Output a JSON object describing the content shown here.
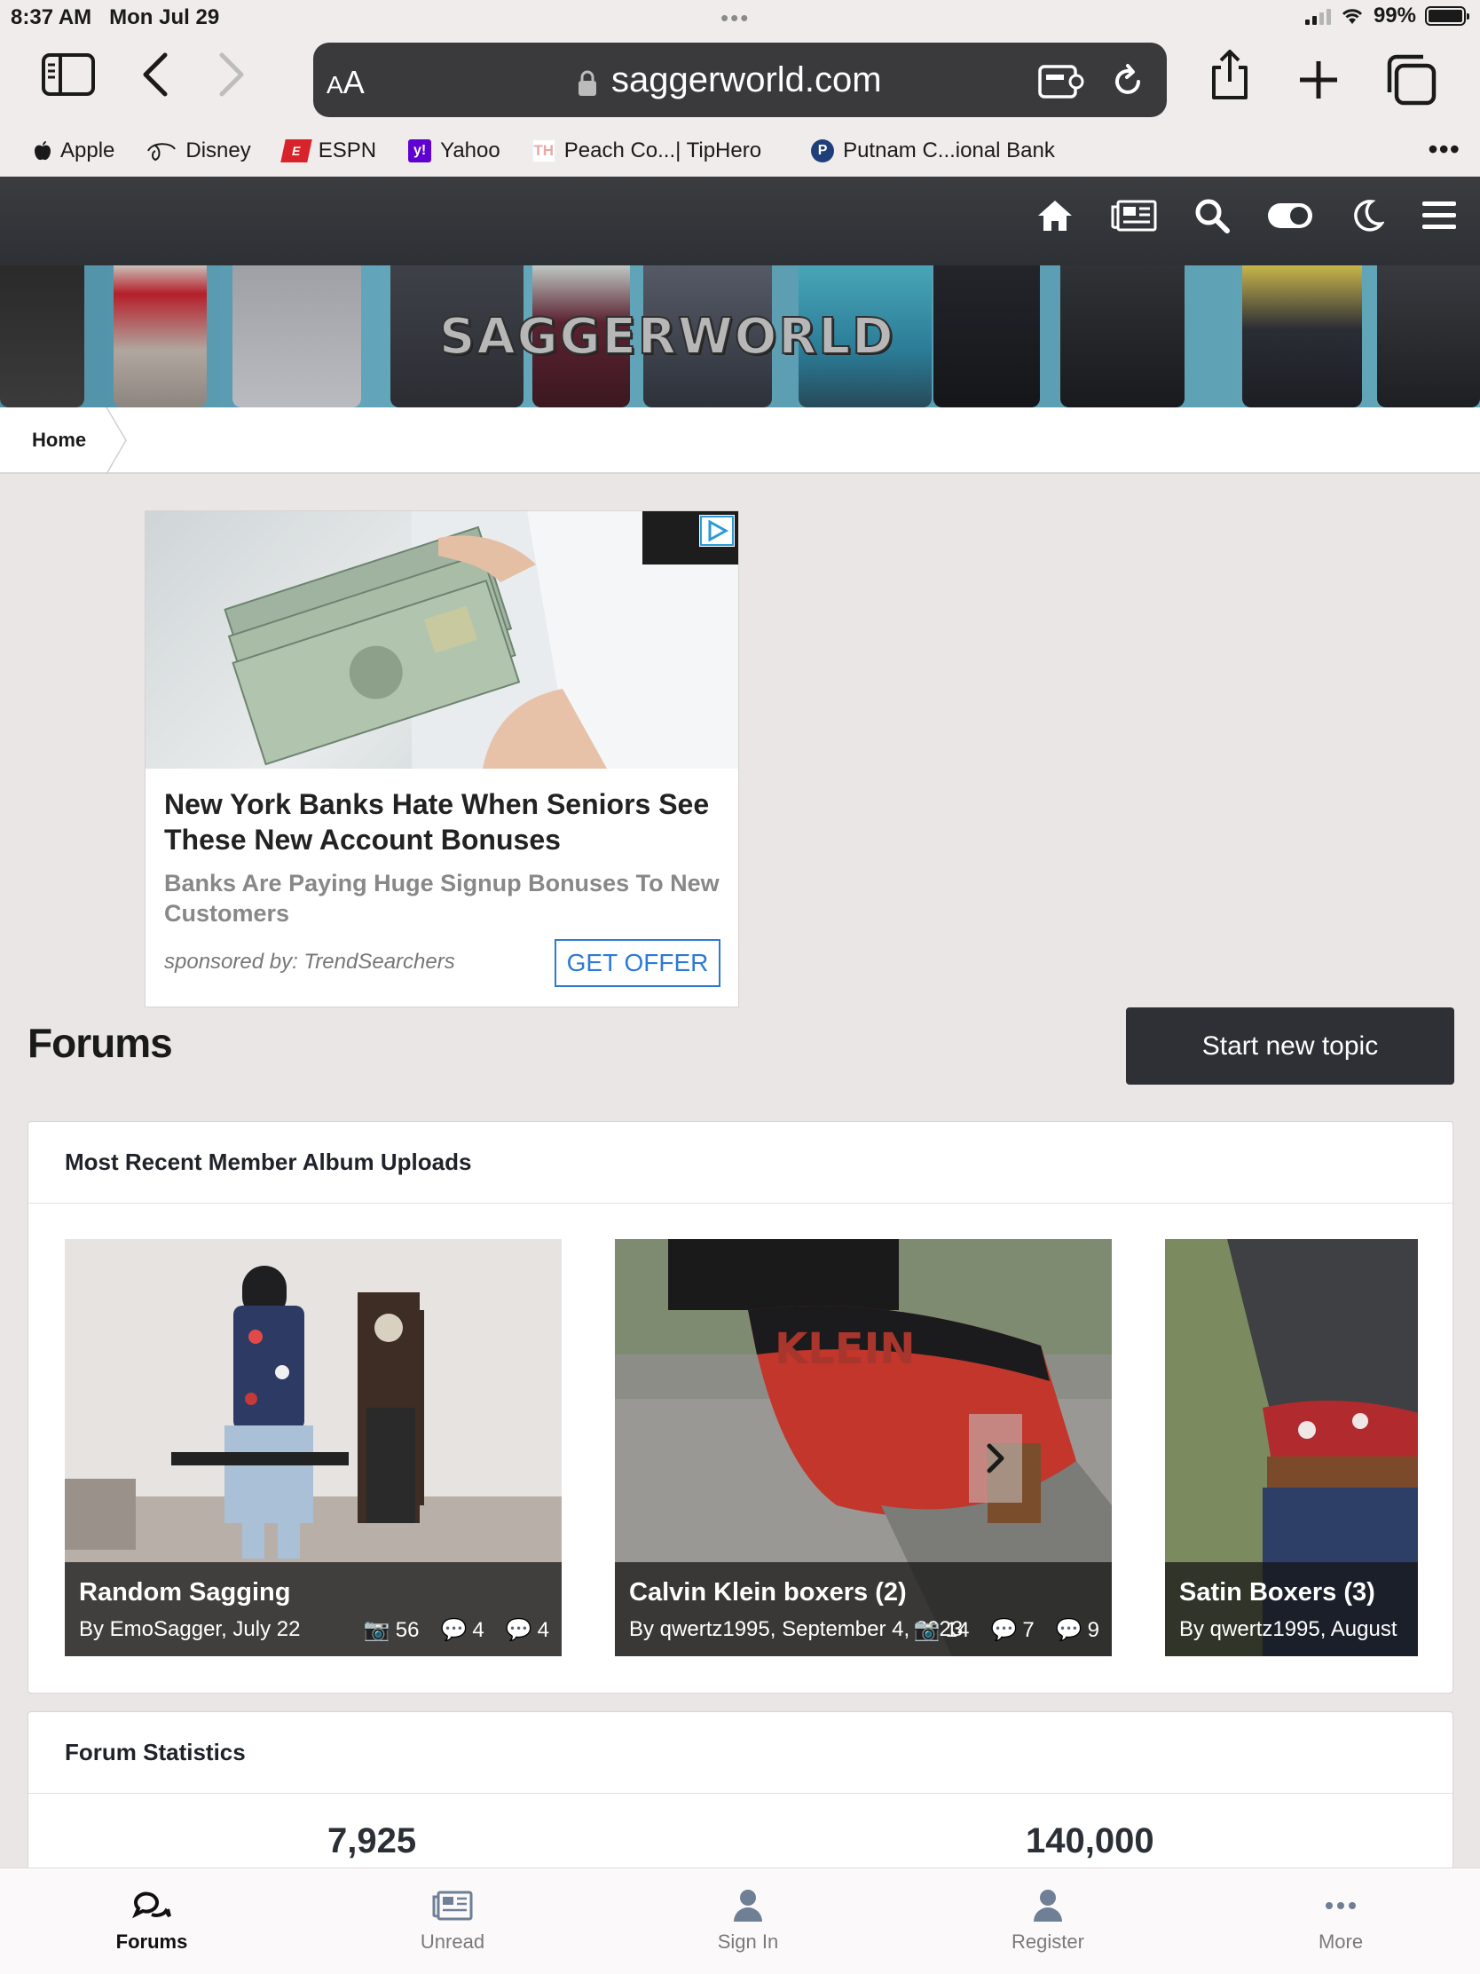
{
  "status_bar": {
    "time": "8:37 AM",
    "date": "Mon Jul 29",
    "battery": "99%",
    "battery_level": 0.99
  },
  "browser": {
    "text_size_label": "AA",
    "url": "saggerworld.com",
    "bookmarks": [
      {
        "label": "Apple",
        "icon": "apple-icon"
      },
      {
        "label": "Disney",
        "icon": "disney-icon"
      },
      {
        "label": "ESPN",
        "icon": "espn-icon"
      },
      {
        "label": "Yahoo",
        "icon": "yahoo-icon"
      },
      {
        "label": "Peach Co...| TipHero",
        "icon": "tiphero-icon"
      },
      {
        "label": "Putnam C...ional Bank",
        "icon": "bank-icon"
      }
    ]
  },
  "site": {
    "banner_title": "SAGGERWORLD",
    "breadcrumb": "Home",
    "nav_icons": [
      "home-icon",
      "news-icon",
      "search-icon",
      "toggle-icon",
      "moon-icon",
      "menu-icon"
    ]
  },
  "ad": {
    "title": "New York Banks Hate When Seniors See These New Account Bonuses",
    "subtitle": "Banks Are Paying Huge Signup Bonuses To New Customers",
    "sponsor": "sponsored by: TrendSearchers",
    "cta": "GET OFFER"
  },
  "forums": {
    "title": "Forums",
    "new_topic": "Start new topic",
    "albums_heading": "Most Recent Member Album Uploads",
    "albums": [
      {
        "title": "Random Sagging",
        "byline": "By EmoSagger, July 22",
        "images": "56",
        "comments": "4",
        "replies": "4"
      },
      {
        "title": "Calvin Klein boxers (2)",
        "byline": "By qwertz1995, September 4, 2023",
        "images": "14",
        "comments": "7",
        "replies": "9"
      },
      {
        "title": "Satin Boxers (3)",
        "byline": "By qwertz1995, August",
        "images": "",
        "comments": "",
        "replies": ""
      }
    ],
    "stats_heading": "Forum Statistics",
    "stats": [
      "7,925",
      "140,000"
    ]
  },
  "tabbar": {
    "items": [
      {
        "label": "Forums",
        "icon": "chat-icon"
      },
      {
        "label": "Unread",
        "icon": "newspaper-icon"
      },
      {
        "label": "Sign In",
        "icon": "user-icon"
      },
      {
        "label": "Register",
        "icon": "user-plus-icon"
      },
      {
        "label": "More",
        "icon": "more-icon"
      }
    ]
  }
}
